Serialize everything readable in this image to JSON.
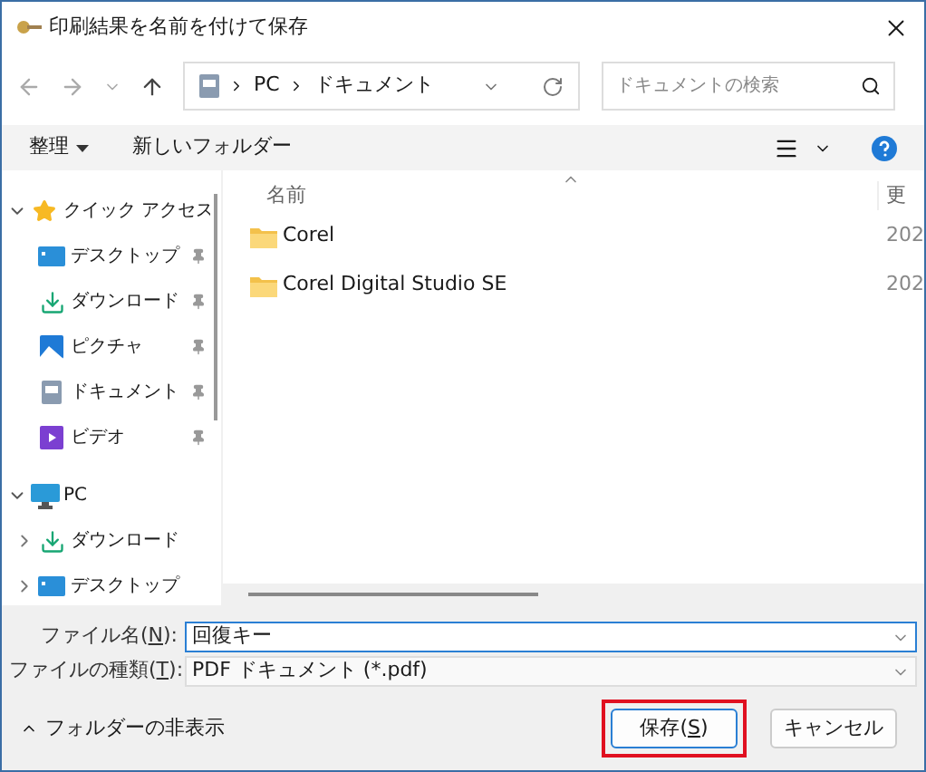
{
  "window": {
    "title": "印刷結果を名前を付けて保存"
  },
  "address": {
    "path": [
      {
        "label": "PC"
      },
      {
        "label": "ドキュメント"
      }
    ]
  },
  "search": {
    "placeholder": "ドキュメントの検索"
  },
  "toolbar": {
    "organize": "整理",
    "new_folder": "新しいフォルダー"
  },
  "sidebar": {
    "items": [
      {
        "label": "クイック アクセス",
        "kind": "star",
        "expanded": true,
        "children": [
          {
            "label": "デスクトップ",
            "kind": "desktop",
            "pinned": true
          },
          {
            "label": "ダウンロード",
            "kind": "download",
            "pinned": true
          },
          {
            "label": "ピクチャ",
            "kind": "pictures",
            "pinned": true
          },
          {
            "label": "ドキュメント",
            "kind": "documents",
            "pinned": true
          },
          {
            "label": "ビデオ",
            "kind": "videos",
            "pinned": true
          }
        ]
      },
      {
        "label": "PC",
        "kind": "pc",
        "expanded": true,
        "children": [
          {
            "label": "ダウンロード",
            "kind": "download",
            "expanded": false
          },
          {
            "label": "デスクトップ",
            "kind": "desktop",
            "expanded": false
          }
        ]
      }
    ]
  },
  "table": {
    "columns": [
      {
        "label": "名前"
      },
      {
        "label": "更"
      }
    ],
    "rows": [
      {
        "name": "Corel",
        "date": "202"
      },
      {
        "name": "Corel Digital Studio SE",
        "date": "202"
      }
    ]
  },
  "fields": [
    {
      "label_before": "ファイル名(",
      "accel": "N",
      "label_after": "):",
      "value": "回復キー"
    },
    {
      "label_before": "ファイルの種類(",
      "accel": "T",
      "label_after": "):",
      "value": "PDF ドキュメント (*.pdf)"
    }
  ],
  "hide_folders": "フォルダーの非表示",
  "buttons": [
    {
      "label_before": "保存(",
      "accel": "S",
      "label_after": ")",
      "highlighted": true,
      "default": true
    },
    {
      "label": "キャンセル",
      "highlighted": false,
      "default": false
    }
  ]
}
